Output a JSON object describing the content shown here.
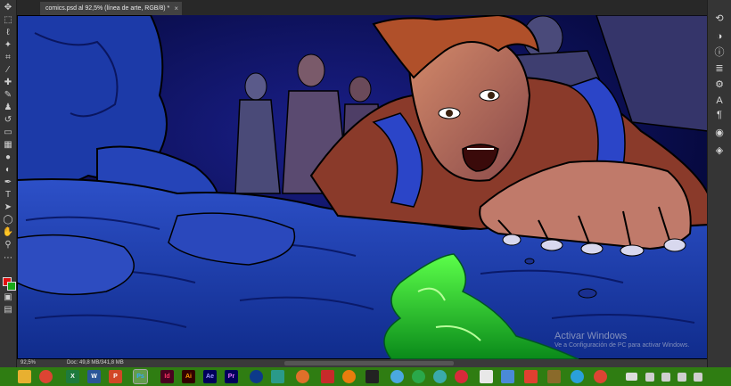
{
  "document": {
    "tab_title": "comics.psd al 92,5% (línea de arte, RGB/8) *",
    "close_symbol": "×"
  },
  "status": {
    "zoom": "92,5%",
    "doc_info": "Doc: 49,8 MB/341,8 MB"
  },
  "watermark": {
    "title": "Activar Windows",
    "subtitle": "Ve a Configuración de PC para activar Windows."
  },
  "colors": {
    "foreground_swatch": "#e01010",
    "background_swatch": "#18a818",
    "taskbar": "#2f7d12"
  },
  "toolbar_left": {
    "tools": [
      "move-icon",
      "marquee-icon",
      "lasso-icon",
      "magic-wand-icon",
      "crop-icon",
      "eyedropper-icon",
      "healing-brush-icon",
      "brush-icon",
      "clone-stamp-icon",
      "history-brush-icon",
      "eraser-icon",
      "gradient-icon",
      "blur-icon",
      "dodge-icon",
      "pen-icon",
      "type-icon",
      "path-selection-icon",
      "shape-icon",
      "hand-icon",
      "zoom-icon",
      "more-tools-icon"
    ]
  },
  "panel_right": {
    "tools": [
      "history-icon",
      "adjustments-icon",
      "info-icon",
      "paragraph-icon",
      "properties-icon",
      "character-icon",
      "pilcrow-icon",
      "swatches-icon",
      "layers-icon"
    ]
  },
  "taskbar": {
    "apps": [
      {
        "icon": "file-explorer-icon",
        "label": ""
      },
      {
        "icon": "chrome-icon",
        "label": ""
      },
      {
        "icon": "excel-icon",
        "label": "X"
      },
      {
        "icon": "word-icon",
        "label": "W"
      },
      {
        "icon": "powerpoint-icon",
        "label": "P"
      },
      {
        "icon": "photoshop-icon",
        "label": "Ps"
      },
      {
        "icon": "indesign-icon",
        "label": "Id"
      },
      {
        "icon": "illustrator-icon",
        "label": "Ai"
      },
      {
        "icon": "after-effects-icon",
        "label": "Ae"
      },
      {
        "icon": "premiere-icon",
        "label": "Pr"
      },
      {
        "icon": "cinema4d-icon",
        "label": ""
      },
      {
        "icon": "houdini-icon",
        "label": ""
      },
      {
        "icon": "app-orange-icon",
        "label": ""
      },
      {
        "icon": "app-red-icon",
        "label": ""
      },
      {
        "icon": "blender-icon",
        "label": ""
      },
      {
        "icon": "zbrush-icon",
        "label": ""
      },
      {
        "icon": "app-round-icon",
        "label": ""
      },
      {
        "icon": "app-green-icon",
        "label": ""
      },
      {
        "icon": "app-teal-icon",
        "label": ""
      },
      {
        "icon": "app-blue-icon",
        "label": ""
      },
      {
        "icon": "app-square-icon",
        "label": ""
      },
      {
        "icon": "app-cross-icon",
        "label": ""
      },
      {
        "icon": "telegram-icon",
        "label": ""
      },
      {
        "icon": "chrome-icon-2",
        "label": ""
      }
    ],
    "tray": [
      "keyboard-icon",
      "tray-icon-1",
      "tray-icon-2",
      "tray-icon-3",
      "tray-icon-4"
    ]
  }
}
